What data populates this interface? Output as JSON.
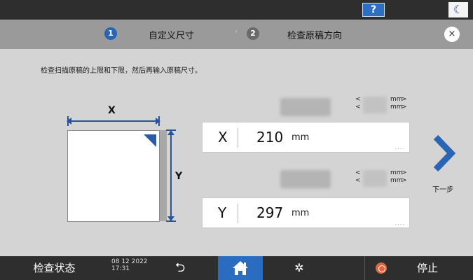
{
  "topbar": {
    "help_label": "?",
    "moon_icon": "moon-icon"
  },
  "steps": [
    {
      "number": "1",
      "label": "自定义尺寸",
      "state": "active"
    },
    {
      "number": "2",
      "label": "检查原稿方向",
      "state": "inactive"
    }
  ],
  "step_separator": "›",
  "close_label": "×",
  "instruction": "检查扫描原稿的上限和下限，然后再输入原稿尺寸。",
  "diagram": {
    "x_label": "X",
    "y_label": "Y"
  },
  "x_field": {
    "axis": "X",
    "value": "210",
    "unit": "mm",
    "range_prefix": "<",
    "range_unit": "mm",
    "range_suffix": ">"
  },
  "y_field": {
    "axis": "Y",
    "value": "297",
    "unit": "mm",
    "range_prefix": "<",
    "range_unit": "mm",
    "range_suffix": ">"
  },
  "field_more": "....",
  "next_label": "下一步",
  "bottombar": {
    "status_label": "检查状态",
    "date": "08 12 2022",
    "time": "17:31",
    "stop_label": "停止"
  },
  "colors": {
    "accent": "#2a65b5",
    "home_bg": "#2a6cc0",
    "stop": "#e2663b",
    "bar_bg": "#2e2e2e",
    "step_bar": "#9a9a9a",
    "page_bg": "#d4d4d4"
  }
}
